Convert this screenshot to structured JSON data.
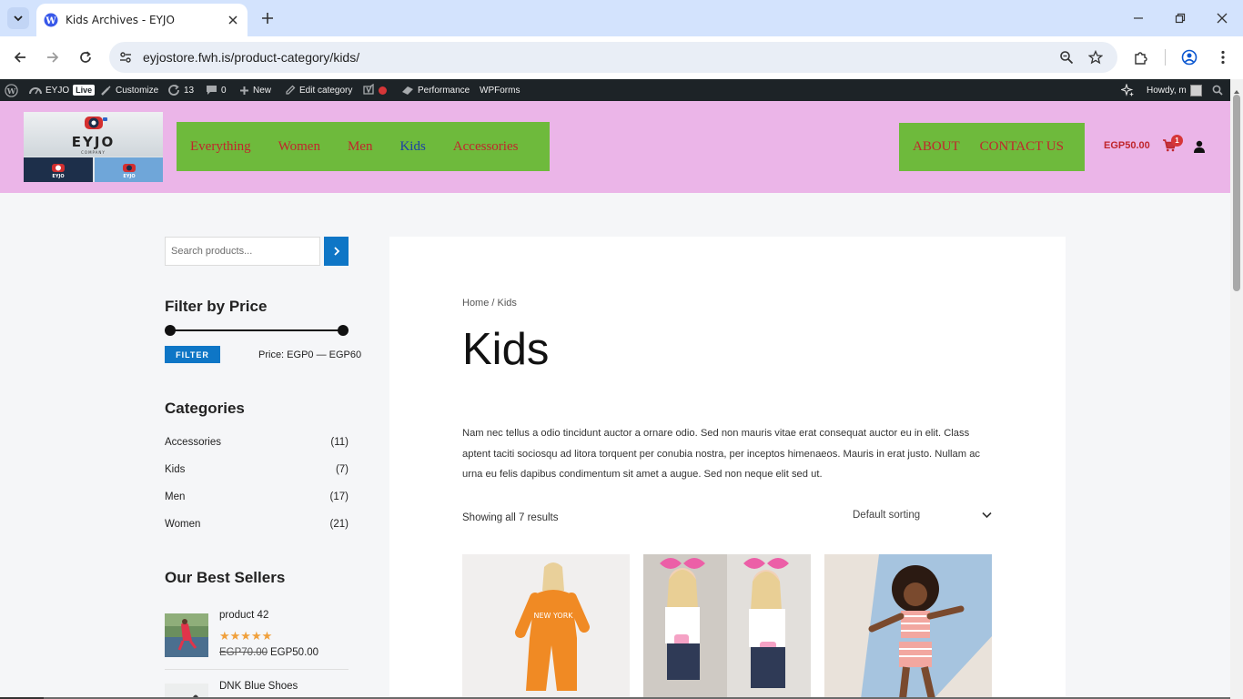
{
  "browser": {
    "tab_title": "Kids Archives - EYJO",
    "url": "eyjostore.fwh.is/product-category/kids/"
  },
  "adminbar": {
    "site_name": "EYJO",
    "live": "Live",
    "customize": "Customize",
    "updates": "13",
    "comments": "0",
    "new": "New",
    "edit_category": "Edit category",
    "performance": "Performance",
    "wpforms": "WPForms",
    "howdy": "Howdy, m"
  },
  "header": {
    "logo_text": "EYJO",
    "logo_sub": "COMPANY",
    "main_nav": [
      "Everything",
      "Women",
      "Men",
      "Kids",
      "Accessories"
    ],
    "active_index": 3,
    "secondary_nav": [
      "ABOUT",
      "CONTACT US"
    ],
    "cart_total": "EGP50.00",
    "cart_count": "1",
    "colors": {
      "header_bg": "#ebb5e8",
      "nav_bg": "#6eba3c",
      "nav_text": "#c0262d",
      "nav_active": "#1d3fa8"
    }
  },
  "sidebar": {
    "search_placeholder": "Search products...",
    "filter_title": "Filter by Price",
    "filter_button": "FILTER",
    "price_text": "Price: EGP0 — EGP60",
    "categories_title": "Categories",
    "categories": [
      {
        "name": "Accessories",
        "count": "(11)"
      },
      {
        "name": "Kids",
        "count": "(7)"
      },
      {
        "name": "Men",
        "count": "(17)"
      },
      {
        "name": "Women",
        "count": "(21)"
      }
    ],
    "best_sellers_title": "Our Best Sellers",
    "best_sellers": [
      {
        "name": "product 42",
        "rating": 5,
        "old_price": "EGP70.00",
        "price": "EGP50.00"
      },
      {
        "name": "DNK Blue Shoes"
      }
    ]
  },
  "main": {
    "breadcrumb": "Home / Kids",
    "title": "Kids",
    "description": "Nam nec tellus a odio tincidunt auctor a ornare odio. Sed non mauris vitae erat consequat auctor eu in elit. Class aptent taciti sociosqu ad litora torquent per conubia nostra, per inceptos himenaeos. Mauris in erat justo. Nullam ac urna eu felis dapibus condimentum sit amet a augue. Sed non neque elit sed ut.",
    "result_count": "Showing all 7 results",
    "sort_value": "Default sorting",
    "products": [
      {
        "image": "girl-orange-tracksuit"
      },
      {
        "image": "girls-pink-bows"
      },
      {
        "image": "girl-striped-outfit"
      }
    ]
  }
}
